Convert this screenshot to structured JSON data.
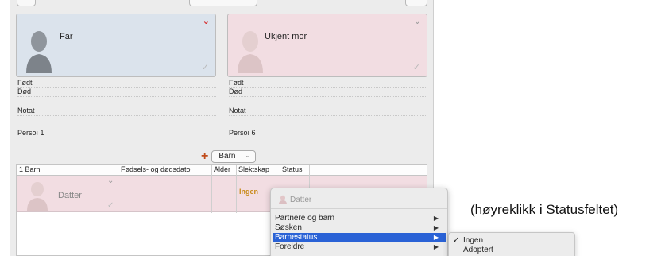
{
  "father": {
    "name": "Far"
  },
  "mother": {
    "name": "Ukjent mor"
  },
  "father_info": {
    "born": "Født",
    "died": "Død",
    "note": "Notat",
    "person": "Persoı 1"
  },
  "mother_info": {
    "born": "Født",
    "died": "Død",
    "note": "Notat",
    "person": "Persoı 6"
  },
  "add_child": {
    "label": "Barn"
  },
  "table": {
    "headers": [
      "1 Barn",
      "Fødsels- og dødsdato",
      "Alder",
      "Slektskap",
      "Status"
    ],
    "row": {
      "name": "Datter",
      "relationship": "Ingen"
    }
  },
  "context_menu": {
    "header": "Datter",
    "items": [
      "Partnere og barn",
      "Søsken",
      "Barnestatus",
      "Foreldre"
    ]
  },
  "submenu": {
    "items": [
      "Ingen",
      "Adoptert"
    ],
    "checked_mark": "✓"
  },
  "annotation": "(høyreklikk i Statusfeltet)",
  "colors": {
    "highlight": "#2a62d6",
    "father_card": "#dbe3ec",
    "mother_card": "#f2dde2",
    "relationship_text": "#c98a1a",
    "add_icon": "#c04b1a"
  }
}
